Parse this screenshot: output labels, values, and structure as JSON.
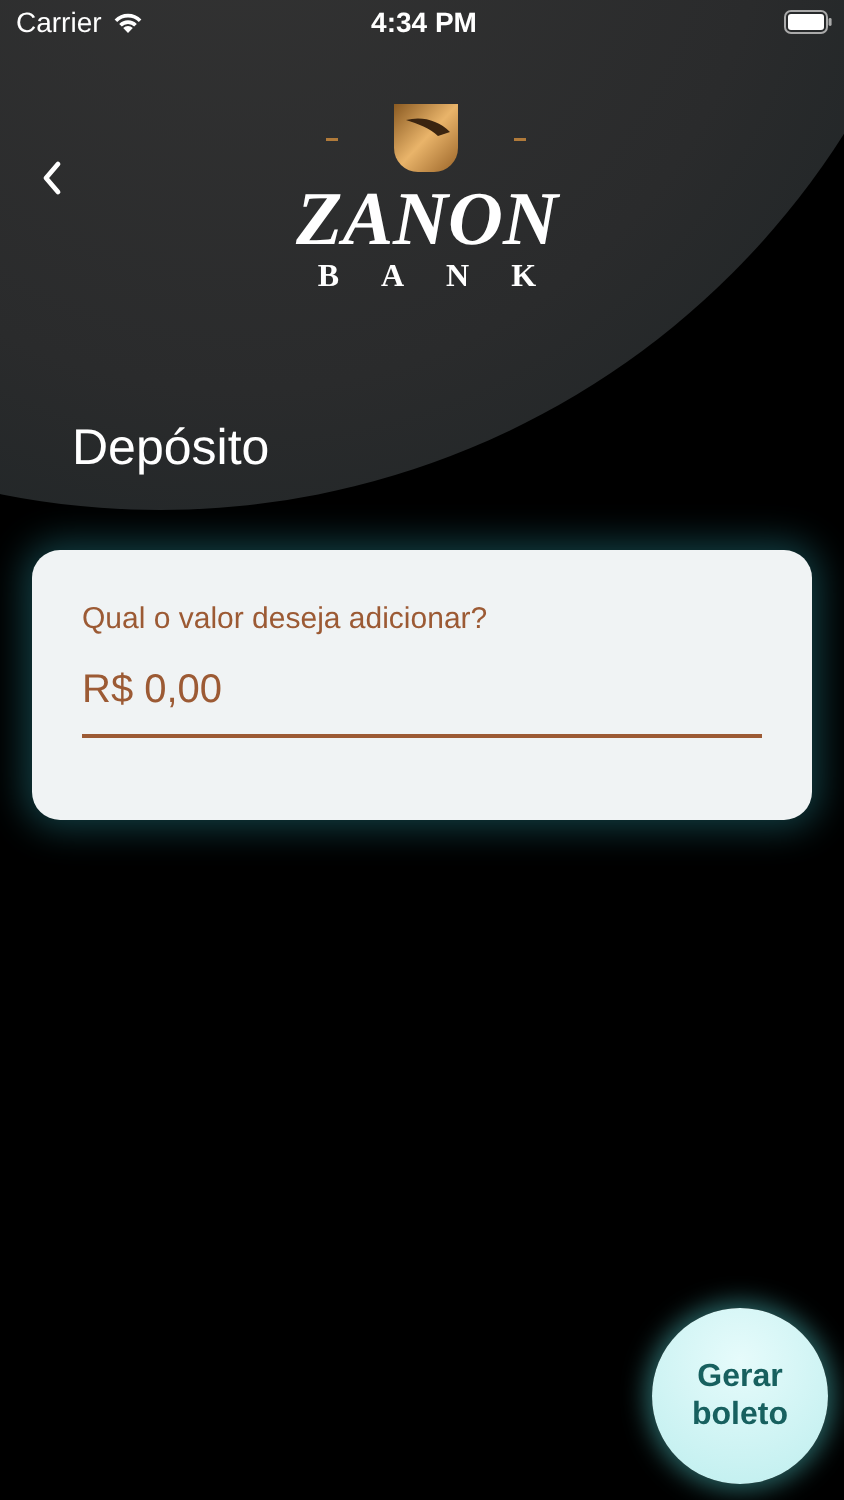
{
  "status_bar": {
    "carrier": "Carrier",
    "time": "4:34 PM"
  },
  "logo": {
    "name": "ZANON",
    "subtitle": "BANK"
  },
  "header": {
    "title": "Depósito"
  },
  "amount_card": {
    "label": "Qual o valor deseja adicionar?",
    "value": "R$ 0,00"
  },
  "action_button": {
    "label": "Gerar boleto"
  }
}
